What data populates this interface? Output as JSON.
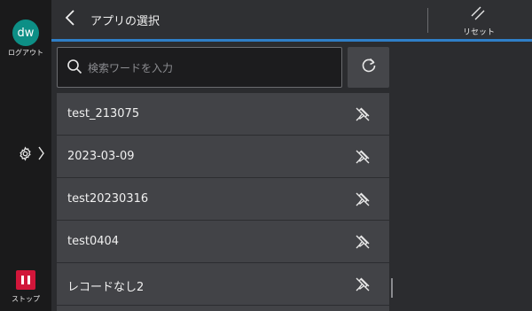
{
  "rail": {
    "avatar_text": "dw",
    "logout_label": "ログアウト",
    "stop_label": "ストップ",
    "colors": {
      "avatar": "#0d8f86",
      "stop": "#d1163a"
    }
  },
  "header": {
    "title": "アプリの選択",
    "reset_label": "リセット",
    "accent": "#2f7fc8"
  },
  "search": {
    "placeholder": "検索ワードを入力"
  },
  "apps": [
    {
      "label": "test_213075"
    },
    {
      "label": "2023-03-09"
    },
    {
      "label": "test20230316"
    },
    {
      "label": "test0404"
    },
    {
      "label": "レコードなし2"
    }
  ]
}
